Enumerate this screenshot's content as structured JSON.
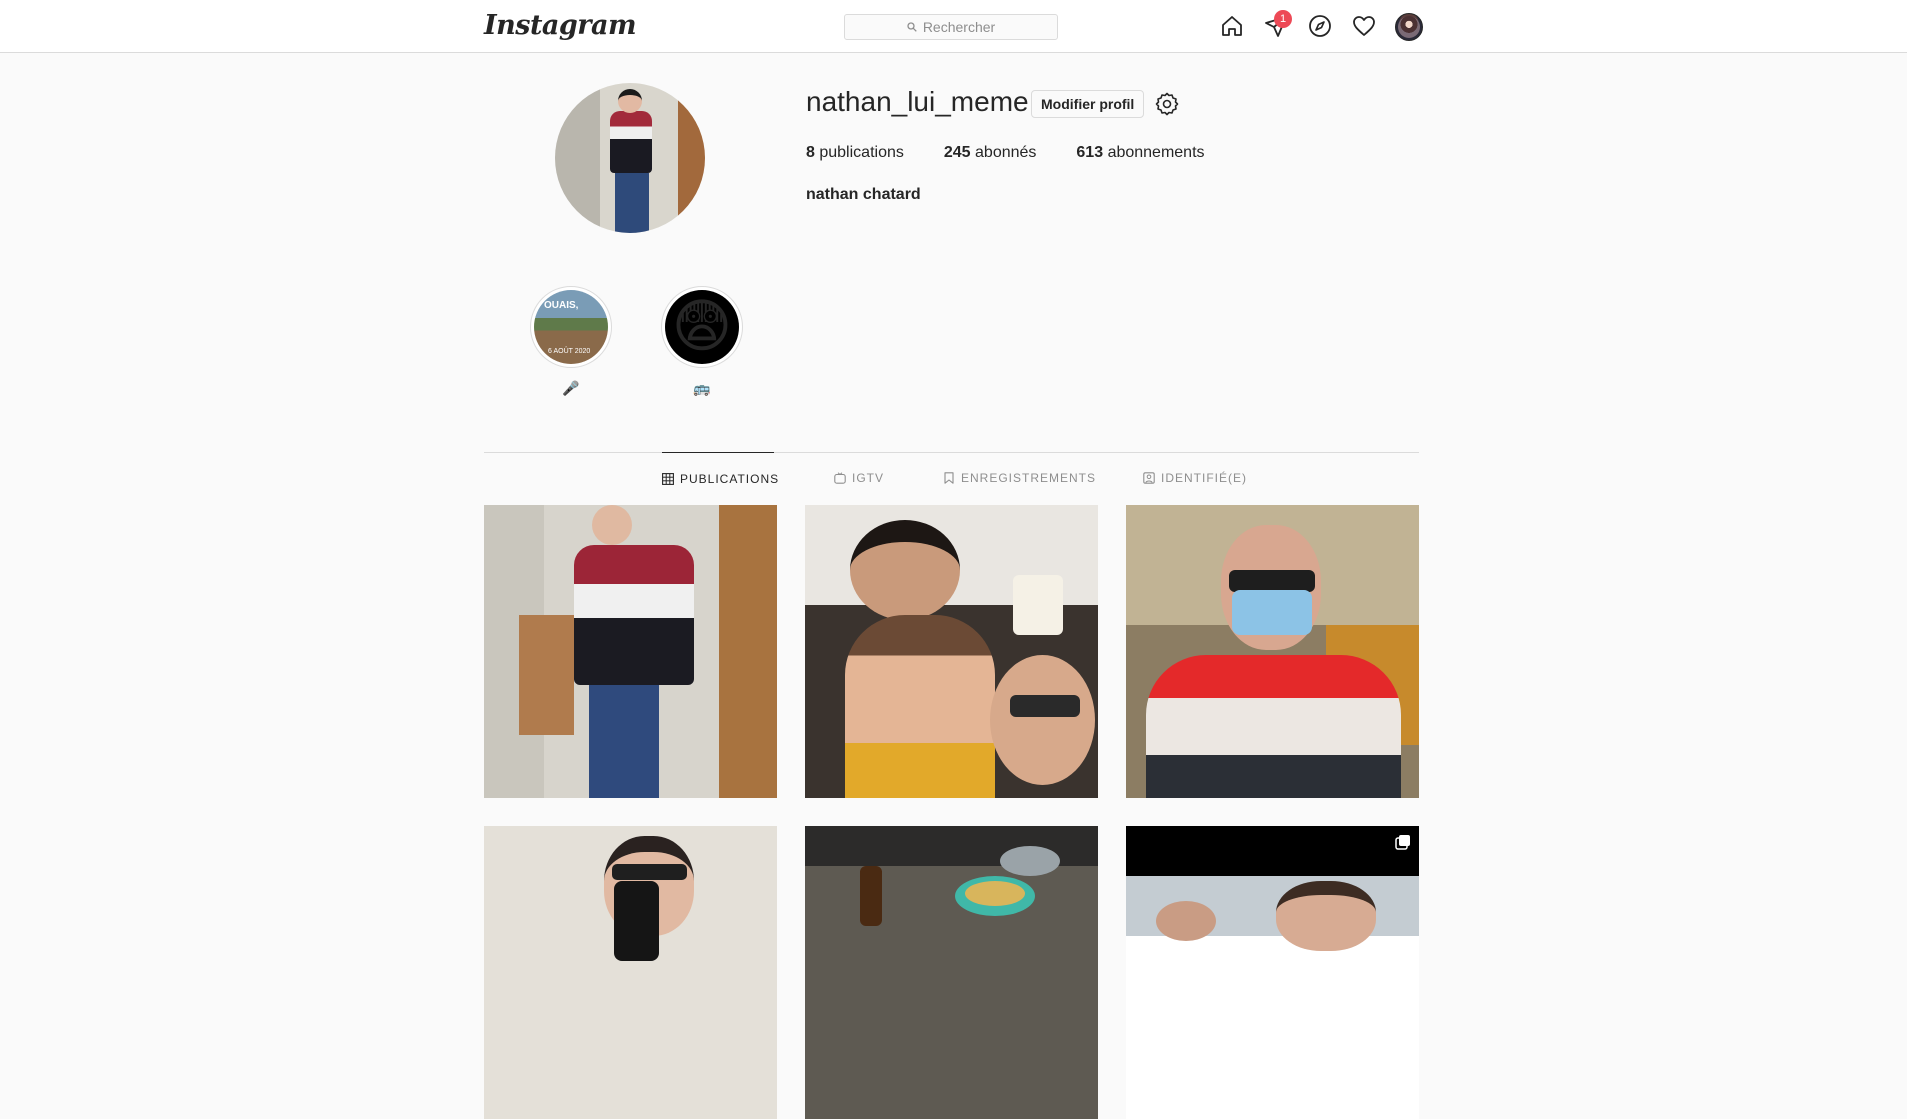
{
  "nav": {
    "logo": "Instagram",
    "search_placeholder": "Rechercher",
    "direct_badge": "1",
    "icons": [
      "home-icon",
      "direct-icon",
      "explore-icon",
      "activity-heart-icon",
      "avatar"
    ]
  },
  "profile": {
    "username": "nathan_lui_meme",
    "edit_label": "Modifier profil",
    "stats": [
      {
        "count": "8",
        "label": "publications"
      },
      {
        "count": "245",
        "label": "abonnés"
      },
      {
        "count": "613",
        "label": "abonnements"
      }
    ],
    "full_name": "nathan chatard"
  },
  "highlights": [
    {
      "cover_text": "OUAIS,",
      "cover_date": "6 AOÛT 2020",
      "label": "🎤"
    },
    {
      "cover_emoji": "😨",
      "label": "🚌"
    }
  ],
  "tabs": [
    {
      "label": "PUBLICATIONS",
      "icon": "grid-icon",
      "active": true
    },
    {
      "label": "IGTV",
      "icon": "igtv-icon",
      "active": false
    },
    {
      "label": "ENREGISTREMENTS",
      "icon": "bookmark-icon",
      "active": false
    },
    {
      "label": "IDENTIFIÉ(E)",
      "icon": "tagged-icon",
      "active": false
    }
  ],
  "colors": {
    "background": "#fafafa",
    "border": "#dbdbdb",
    "text": "#262626",
    "muted": "#8e8e8e",
    "badge": "#ed4956"
  }
}
